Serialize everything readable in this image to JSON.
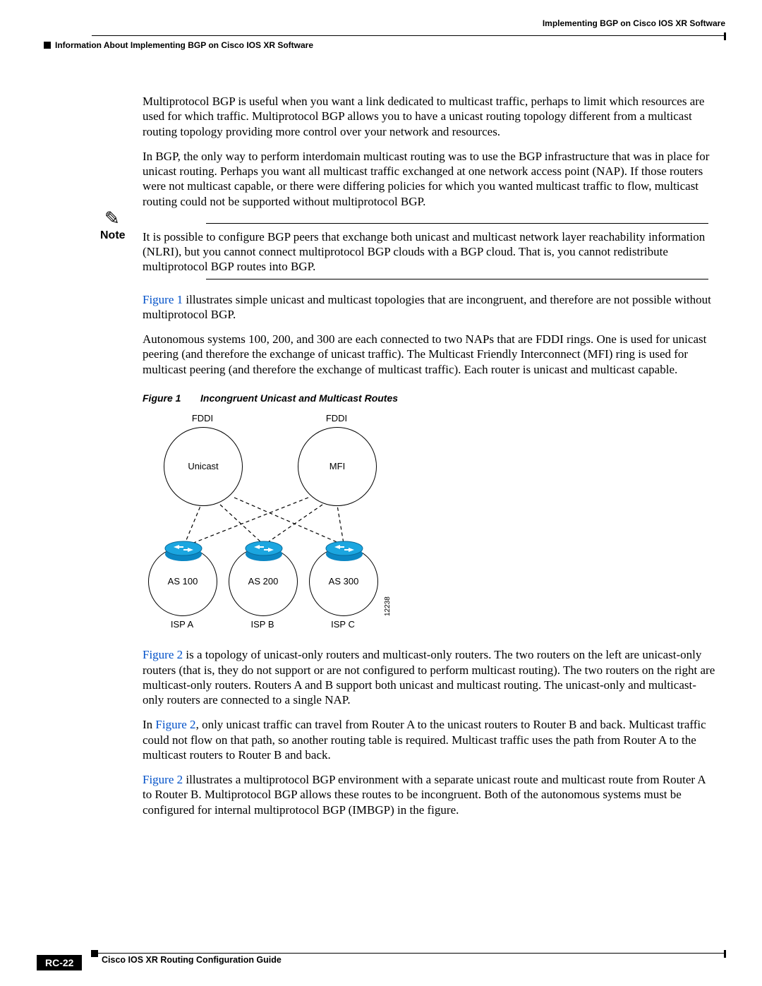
{
  "header": {
    "chapter": "Implementing BGP on Cisco IOS XR Software",
    "section": "Information About Implementing BGP on Cisco IOS XR Software"
  },
  "paragraphs": {
    "p1": "Multiprotocol BGP is useful when you want a link dedicated to multicast traffic, perhaps to limit which resources are used for which traffic. Multiprotocol BGP allows you to have a unicast routing topology different from a multicast routing topology providing more control over your network and resources.",
    "p2": "In BGP, the only way to perform interdomain multicast routing was to use the BGP infrastructure that was in place for unicast routing. Perhaps you want all multicast traffic exchanged at one network access point (NAP). If those routers were not multicast capable, or there were differing policies for which you wanted multicast traffic to flow, multicast routing could not be supported without multiprotocol BGP.",
    "note_label": "Note",
    "note": "It is possible to configure BGP peers that exchange both unicast and multicast network layer reachability information (NLRI), but you cannot connect multiprotocol BGP clouds with a BGP cloud. That is, you cannot redistribute multiprotocol BGP routes into BGP.",
    "p3a": "Figure 1",
    "p3b": " illustrates simple unicast and multicast topologies that are incongruent, and therefore are not possible without multiprotocol BGP.",
    "p4": "Autonomous systems 100, 200, and 300 are each connected to two NAPs that are FDDI rings. One is used for unicast peering (and therefore the exchange of unicast traffic). The Multicast Friendly Interconnect (MFI) ring is used for multicast peering (and therefore the exchange of multicast traffic). Each router is unicast and multicast capable.",
    "p5a": "Figure 2",
    "p5b": " is a topology of unicast-only routers and multicast-only routers. The two routers on the left are unicast-only routers (that is, they do not support or are not configured to perform multicast routing). The two routers on the right are multicast-only routers. Routers A and B support both unicast and multicast routing. The unicast-only and multicast-only routers are connected to a single NAP.",
    "p6a": "In ",
    "p6b": "Figure 2",
    "p6c": ", only unicast traffic can travel from Router A to the unicast routers to Router B and back. Multicast traffic could not flow on that path, so another routing table is required. Multicast traffic uses the path from Router A to the multicast routers to Router B and back.",
    "p7a": "Figure 2",
    "p7b": " illustrates a multiprotocol BGP environment with a separate unicast route and multicast route from Router A to Router B. Multiprotocol BGP allows these routes to be incongruent. Both of the autonomous systems must be configured for internal multiprotocol BGP (IMBGP) in the figure."
  },
  "figure1": {
    "num": "Figure 1",
    "title": "Incongruent Unicast and Multicast Routes",
    "fdd_left": "FDDI",
    "fdd_right": "FDDI",
    "ring_left": "Unicast",
    "ring_right": "MFI",
    "as100": "AS 100",
    "as200": "AS 200",
    "as300": "AS 300",
    "ispA": "ISP A",
    "ispB": "ISP B",
    "ispC": "ISP C",
    "image_id": "12238"
  },
  "footer": {
    "doc_title": "Cisco IOS XR Routing Configuration Guide",
    "page": "RC-22"
  }
}
